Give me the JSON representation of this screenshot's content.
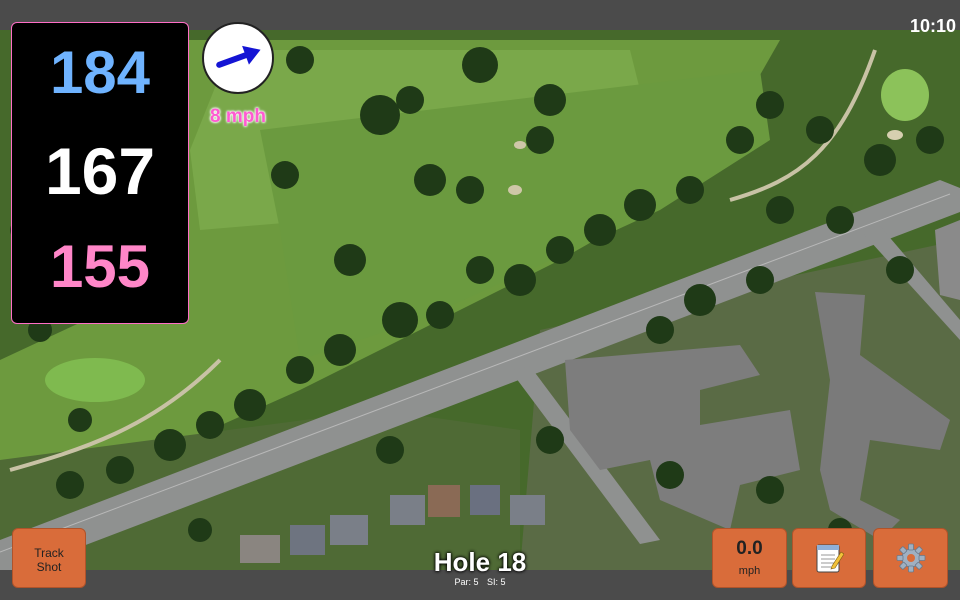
{
  "status": {
    "time": "10:10"
  },
  "distances": {
    "back": "184",
    "middle": "167",
    "front": "155"
  },
  "wind": {
    "speed": "8 mph",
    "arrow_icon": "arrow-right-icon"
  },
  "hole": {
    "title": "Hole 18",
    "par": "Par: 5",
    "si": "SI: 5"
  },
  "buttons": {
    "track_line1": "Track",
    "track_line2": "Shot",
    "speed_value": "0.0",
    "speed_unit": "mph",
    "notes_icon": "notepad-icon",
    "settings_icon": "gear-icon"
  },
  "colors": {
    "back_distance": "#6fb3ff",
    "middle_distance": "#ffffff",
    "front_distance": "#ff86c8",
    "wind_text": "#ff5ad1",
    "button_accent": "#d96c3a"
  }
}
